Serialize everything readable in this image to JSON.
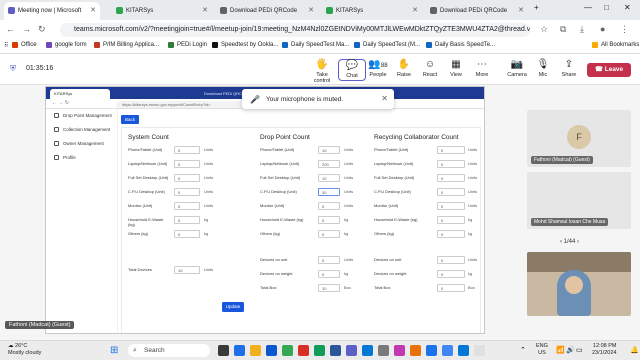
{
  "browser": {
    "tabs": [
      {
        "label": "Meeting now | Microsoft",
        "active": true,
        "color": "#5b5fc7"
      },
      {
        "label": "KITARSys",
        "active": false,
        "color": "#2ea44f"
      },
      {
        "label": "Download PEDi QRCode",
        "active": false,
        "color": "#5f6368"
      },
      {
        "label": "KITARSys",
        "active": false,
        "color": "#2ea44f"
      },
      {
        "label": "Download PEDi QRCode",
        "active": false,
        "color": "#5f6368"
      }
    ],
    "url": "teams.microsoft.com/v2/?meetingjoin=true#/l/meetup-join/19:meeting_NzM4Nzl0ZGEtNDViMy00MTJlLWEwMDktZTQyZTE3MWU4ZTA2@thread.v2/0?co...",
    "bookmarks": [
      {
        "label": "Office",
        "color": "#d83b01"
      },
      {
        "label": "google form",
        "color": "#7248b9"
      },
      {
        "label": "P/IM Billing Applica...",
        "color": "#c0392b"
      },
      {
        "label": "PEDi Login",
        "color": "#2e7d32"
      },
      {
        "label": "Speedtest by Ookla...",
        "color": "#111111"
      },
      {
        "label": "Daily SpeedTest Ma...",
        "color": "#1565c0"
      },
      {
        "label": "Daily SpeedTest (M...",
        "color": "#1565c0"
      },
      {
        "label": "Daily Basis SpeedTe...",
        "color": "#1565c0"
      }
    ],
    "all_bookmarks": "All Bookmarks"
  },
  "teams": {
    "timer": "01:35:16",
    "controls": [
      {
        "label": "Take control",
        "icon": "take-control-icon"
      },
      {
        "label": "Chat",
        "icon": "chat-icon"
      },
      {
        "label": "People",
        "icon": "people-icon",
        "count": "88"
      },
      {
        "label": "Raise",
        "icon": "raise-hand-icon"
      },
      {
        "label": "React",
        "icon": "react-icon"
      },
      {
        "label": "View",
        "icon": "view-icon"
      },
      {
        "label": "More",
        "icon": "more-icon"
      },
      {
        "label": "Camera",
        "icon": "camera-icon"
      },
      {
        "label": "Mic",
        "icon": "mic-icon"
      },
      {
        "label": "Share",
        "icon": "share-icon"
      }
    ],
    "leave_label": "Leave",
    "leave_color": "#c4314b",
    "toast": "Your microphone is muted.",
    "participants": [
      {
        "name": "Fathoni (Madcat) (Guest)",
        "initial": "F"
      },
      {
        "name": "Mohd Shamsul Iosan Che Musa"
      },
      {
        "name": ""
      }
    ],
    "pager": "1/44",
    "self_name": "Fathoni (Madcat) (Guest)"
  },
  "shared_screen": {
    "tabs": [
      "KITARSys",
      "Download PEDi QRCode - kitar..."
    ],
    "url": "https://kitarsys.mcmc.gov.my/pedi/CountEntry?id=",
    "sidebar": [
      "Drop Point Management",
      "Collection Management",
      "Owner Management",
      "Profile"
    ],
    "back_label": "Back",
    "update_label": "Update",
    "columns": [
      {
        "title": "System Count",
        "rows": [
          {
            "label": "Phone/Tablet (Unit)",
            "value": "0",
            "unit": "Units"
          },
          {
            "label": "Laptop/Netbook (Unit)",
            "value": "0",
            "unit": "Units"
          },
          {
            "label": "Full Set Desktop (Unit)",
            "value": "0",
            "unit": "Units"
          },
          {
            "label": "C.P.U Desktop (Unit)",
            "value": "0",
            "unit": "Units"
          },
          {
            "label": "Monitor (Unit)",
            "value": "0",
            "unit": "Units"
          },
          {
            "label": "Household E-Waste (kg)",
            "value": "0",
            "unit": "kg"
          },
          {
            "label": "Others (kg)",
            "value": "0",
            "unit": "kg"
          },
          {
            "label": "Total Devices",
            "value": "10",
            "unit": "Units"
          }
        ]
      },
      {
        "title": "Drop Point Count",
        "rows": [
          {
            "label": "Phone/Tablet (Unit)",
            "value": "10",
            "unit": "Units"
          },
          {
            "label": "Laptop/Netbook (Unit)",
            "value": "200",
            "unit": "Units"
          },
          {
            "label": "Full Set Desktop (Unit)",
            "value": "10",
            "unit": "Units"
          },
          {
            "label": "C.P.U Desktop (Unit)",
            "value": "30",
            "unit": "Units"
          },
          {
            "label": "Monitor (Unit)",
            "value": "0",
            "unit": "Units"
          },
          {
            "label": "Household E-Waste (kg)",
            "value": "0",
            "unit": "kg"
          },
          {
            "label": "Others (kg)",
            "value": "0",
            "unit": "kg"
          },
          {
            "label": "Devices on unit",
            "value": "0",
            "unit": "Units"
          },
          {
            "label": "Devices on weight",
            "value": "0",
            "unit": "kg"
          },
          {
            "label": "Total Box",
            "value": "10",
            "unit": "Box"
          }
        ]
      },
      {
        "title": "Recycling Collaborator Count",
        "rows": [
          {
            "label": "Phone/Tablet (Unit)",
            "value": "0",
            "unit": "Units"
          },
          {
            "label": "Laptop/Netbook (Unit)",
            "value": "0",
            "unit": "Units"
          },
          {
            "label": "Full Set Desktop (Unit)",
            "value": "0",
            "unit": "Units"
          },
          {
            "label": "C.P.U Desktop (Unit)",
            "value": "0",
            "unit": "Units"
          },
          {
            "label": "Monitor (Unit)",
            "value": "0",
            "unit": "Units"
          },
          {
            "label": "Household E-Waste (kg)",
            "value": "0",
            "unit": "kg"
          },
          {
            "label": "Others (kg)",
            "value": "0",
            "unit": "kg"
          },
          {
            "label": "Devices on unit",
            "value": "0",
            "unit": "Units"
          },
          {
            "label": "Devices on weight",
            "value": "0",
            "unit": "kg"
          },
          {
            "label": "Total Box",
            "value": "0",
            "unit": "Box"
          }
        ]
      }
    ]
  },
  "taskbar": {
    "temperature": "26°C",
    "weather": "Mostly cloudy",
    "search": "Search",
    "lang": "ENG",
    "region": "US",
    "time": "12:08 PM",
    "date": "23/1/2024"
  }
}
